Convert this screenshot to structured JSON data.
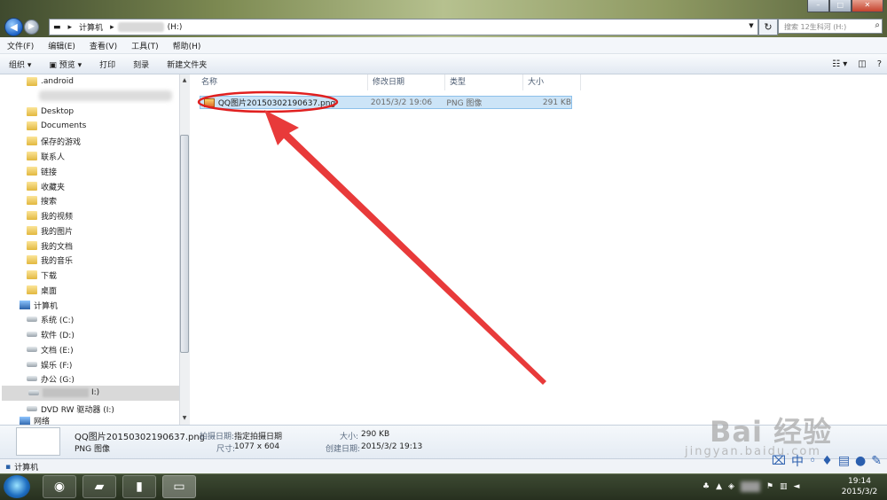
{
  "window": {
    "controls": {
      "minimize": "–",
      "maximize": "□",
      "close": "✕"
    }
  },
  "address_bar": {
    "segments": [
      "计算机",
      "(H:)"
    ],
    "separator": "▸",
    "search_placeholder": "搜索 12生科河 (H:)"
  },
  "menu": [
    "文件(F)",
    "编辑(E)",
    "查看(V)",
    "工具(T)",
    "帮助(H)"
  ],
  "toolbar": {
    "organize": "组织 ▾",
    "preview": "预览 ▾",
    "print": "打印",
    "burn": "刻录",
    "new_folder": "新建文件夹"
  },
  "nav_pane": {
    "items": [
      {
        "label": ".android",
        "icon": "folder-icon"
      },
      {
        "label": "Desktop",
        "icon": "folder-icon"
      },
      {
        "label": "Documents",
        "icon": "folder-icon"
      },
      {
        "label": "保存的游戏",
        "icon": "folder-icon"
      },
      {
        "label": "联系人",
        "icon": "folder-icon"
      },
      {
        "label": "链接",
        "icon": "folder-icon"
      },
      {
        "label": "收藏夹",
        "icon": "folder-icon"
      },
      {
        "label": "搜索",
        "icon": "folder-icon"
      },
      {
        "label": "我的视频",
        "icon": "folder-icon"
      },
      {
        "label": "我的图片",
        "icon": "folder-icon"
      },
      {
        "label": "我的文档",
        "icon": "folder-icon"
      },
      {
        "label": "我的音乐",
        "icon": "folder-icon"
      },
      {
        "label": "下载",
        "icon": "folder-icon"
      },
      {
        "label": "桌面",
        "icon": "folder-icon"
      }
    ],
    "computer": "计算机",
    "drives": [
      "系统 (C:)",
      "软件 (D:)",
      "文档 (E:)",
      "娱乐 (F:)",
      "办公 (G:)"
    ],
    "selected_drive": "I:)",
    "dvd": "DVD RW 驱动器 (I:)",
    "network": "网络"
  },
  "columns": [
    "名称",
    "修改日期",
    "类型",
    "大小"
  ],
  "file": {
    "name": "QQ图片20150302190637.png",
    "modified": "2015/3/2 19:06",
    "type": "PNG 图像",
    "size": "291 KB"
  },
  "details": {
    "filename": "QQ图片20150302190637.png",
    "filetype": "PNG 图像",
    "shot_date_label": "拍摄日期:",
    "shot_date_value": "指定拍摄日期",
    "dimensions_label": "尺寸:",
    "dimensions_value": "1077 x 604",
    "size_label": "大小:",
    "size_value": "290 KB",
    "created_label": "创建日期:",
    "created_value": "2015/3/2 19:13"
  },
  "status": {
    "text": "计算机"
  },
  "watermark": {
    "main": "Bai 经验",
    "sub": "jingyan.baidu.com"
  },
  "clock": {
    "time": "19:14",
    "date": "2015/3/2"
  },
  "colors": {
    "highlight_circle": "#e02020",
    "arrow": "#e83a3a",
    "selection": "#cce4f7"
  }
}
